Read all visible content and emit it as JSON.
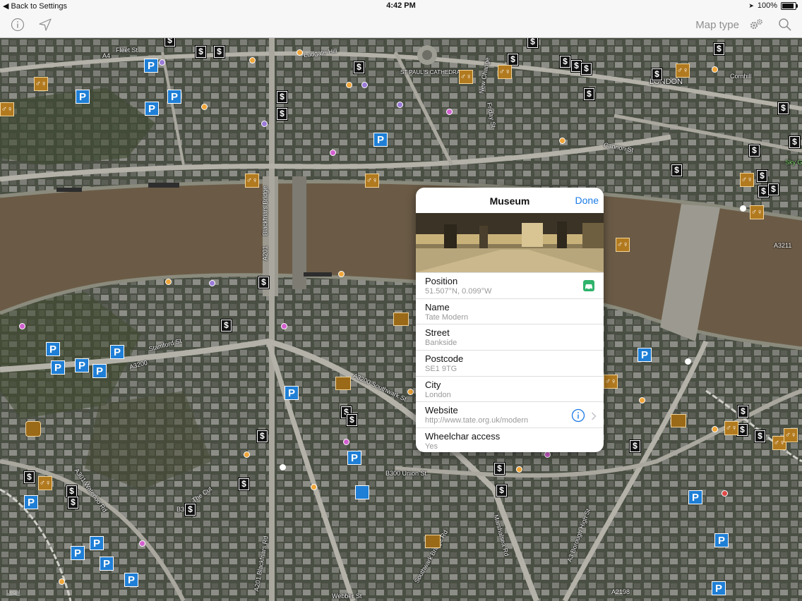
{
  "status_bar": {
    "back": "Back to Settings",
    "time": "4:42 PM",
    "battery_text": "100%",
    "battery_level": 1.0
  },
  "nav_bar": {
    "map_type_label": "Map type"
  },
  "map": {
    "legal": "Legal",
    "labels": [
      "Ludgate Hill",
      "Fleet St",
      "ST PAUL'S CATHEDRAL",
      "New Change",
      "Friday St",
      "LONDON",
      "Cornhill",
      "Cannon St",
      "Blackfriars Bridge",
      "A201",
      "Stamford St",
      "A3200",
      "A3200 Southwark St",
      "A301 Waterloo Rd",
      "The Cut",
      "B300 Union St",
      "A201 Blackfriars Rd",
      "Southwark Bridge Rd",
      "Marshalsea Rd",
      "A3 Borough High St",
      "Webber St",
      "A2198",
      "A3211",
      "Sky G",
      "A4",
      "B3"
    ]
  },
  "popover": {
    "title": "Museum",
    "done": "Done",
    "rows": [
      {
        "label": "Position",
        "value": "51.507°N, 0.099°W"
      },
      {
        "label": "Name",
        "value": "Tate Modern"
      },
      {
        "label": "Street",
        "value": "Bankside"
      },
      {
        "label": "Postcode",
        "value": "SE1 9TG"
      },
      {
        "label": "City",
        "value": "London"
      },
      {
        "label": "Website",
        "value": "http://www.tate.org.uk/modern"
      },
      {
        "label": "Wheelchar access",
        "value": "Yes"
      }
    ]
  },
  "colors": {
    "accent": "#1c7ce6",
    "parking": "#1f7fd6",
    "river": "#6b5b46",
    "toilet": "#b27a1f"
  },
  "icons": [
    "info-icon",
    "location-arrow-icon",
    "settings-gears-icon",
    "search-icon",
    "car-icon",
    "info-circle-icon",
    "chevron-right-icon"
  ]
}
